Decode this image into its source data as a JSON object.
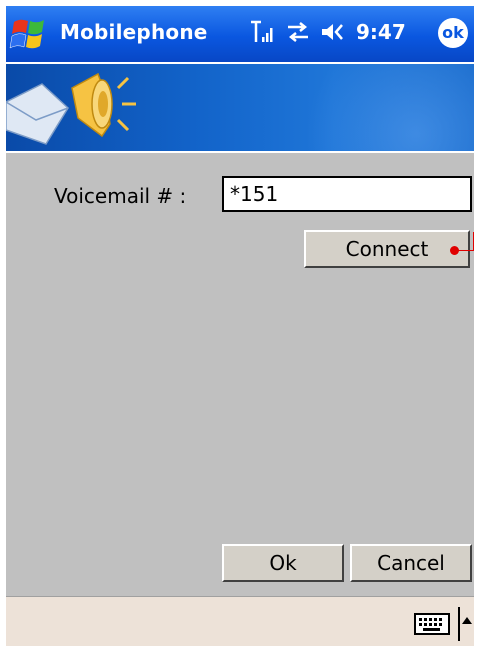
{
  "titlebar": {
    "app_title": "Mobilephone",
    "clock": "9:47",
    "ok_label": "ok",
    "icons": [
      "windows-start-icon",
      "signal-strength-icon",
      "connectivity-icon",
      "volume-icon"
    ]
  },
  "form": {
    "voicemail_label": "Voicemail # :",
    "voicemail_value": "*151",
    "connect_label": "Connect",
    "ok_label": "Ok",
    "cancel_label": "Cancel"
  },
  "bottombar": {
    "icons": [
      "keyboard-icon",
      "sip-up-arrow-icon"
    ]
  },
  "colors": {
    "titlebar": "#0a57e0",
    "background": "#c0c0c0",
    "bottombar": "#ede2d8",
    "marker": "#e00000"
  }
}
